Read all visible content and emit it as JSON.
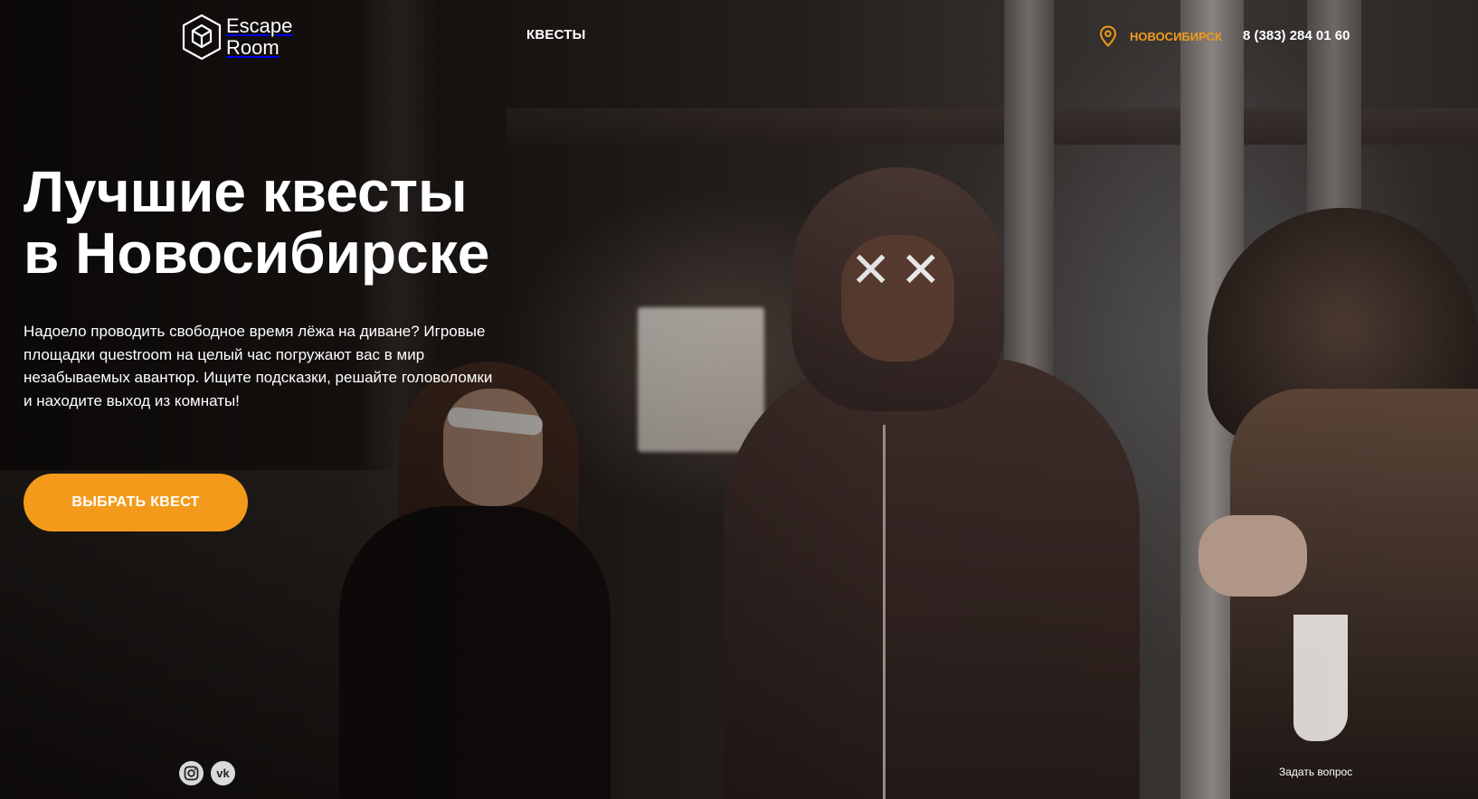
{
  "header": {
    "logo": {
      "line1": "Escape",
      "line2": "Room",
      "icon": "cube-icon"
    },
    "nav": {
      "quests_label": "КВЕСТЫ"
    },
    "city": {
      "label": "НОВОСИБИРСК",
      "icon": "location-pin-icon"
    },
    "phone": "8 (383) 284 01 60"
  },
  "hero": {
    "title_line1": "Лучшие квесты",
    "title_line2": "в Новосибирске",
    "description": "Надоело проводить свободное время лёжа на диване? Игровые площадки questroom на целый час погружают вас в мир незабываемых авантюр. Ищите подсказки, решайте головоломки и находите выход из комнаты!",
    "cta_label": "ВЫБРАТЬ КВЕСТ"
  },
  "social": [
    {
      "name": "instagram",
      "icon": "instagram-icon"
    },
    {
      "name": "vk",
      "icon": "vk-icon",
      "glyph": "vk"
    }
  ],
  "footer": {
    "ask_label": "Задать вопрос"
  },
  "colors": {
    "accent": "#f39a1b",
    "text": "#ffffff",
    "social_bg": "#d9d9d9"
  }
}
